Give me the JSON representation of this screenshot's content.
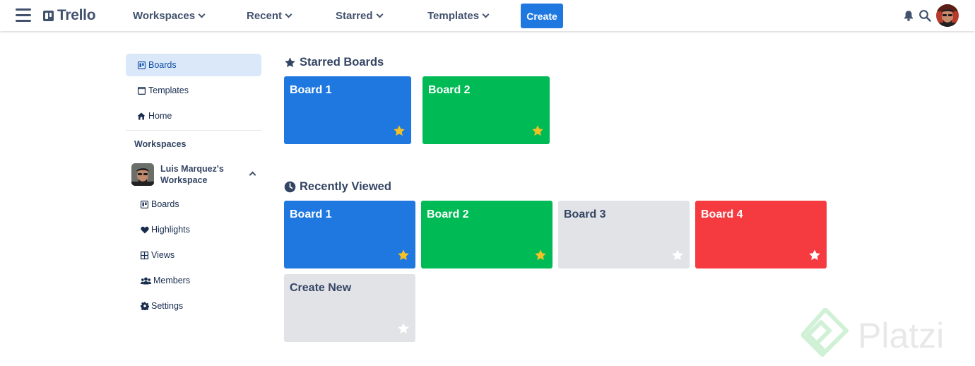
{
  "header": {
    "app_name": "Trello",
    "nav": [
      "Workspaces",
      "Recent",
      "Starred",
      "Templates"
    ],
    "create_label": "Create"
  },
  "sidebar": {
    "links": [
      {
        "label": "Boards",
        "icon": "board-icon",
        "active": true
      },
      {
        "label": "Templates",
        "icon": "template-icon",
        "active": false
      },
      {
        "label": "Home",
        "icon": "home-icon",
        "active": false
      }
    ],
    "workspaces_heading": "Workspaces",
    "workspace_name": "Luis Marquez's Workspace",
    "workspace_links": [
      {
        "label": "Boards",
        "icon": "board-icon"
      },
      {
        "label": "Highlights",
        "icon": "heart-icon"
      },
      {
        "label": "Views",
        "icon": "grid-icon"
      },
      {
        "label": "Members",
        "icon": "members-icon"
      },
      {
        "label": "Settings",
        "icon": "gear-icon"
      }
    ]
  },
  "starred": {
    "title": "Starred Boards",
    "icon": "star-icon",
    "boards": [
      {
        "title": "Board 1",
        "color": "#1f78e0",
        "starred": true
      },
      {
        "title": "Board 2",
        "color": "#00bb55",
        "starred": true
      }
    ]
  },
  "recent": {
    "title": "Recently Viewed",
    "icon": "clock-icon",
    "boards": [
      {
        "title": "Board 1",
        "color": "#1f78e0",
        "starred": true
      },
      {
        "title": "Board 2",
        "color": "#00bb55",
        "starred": true
      },
      {
        "title": "Board 3",
        "color": "#e1e3e7",
        "starred": false
      },
      {
        "title": "Board 4",
        "color": "#f53b40",
        "starred": false
      }
    ],
    "create_new_label": "Create New"
  },
  "colors": {
    "accent": "#1f78e0",
    "star_yellow": "#f4c025",
    "sidebar_active": "#dbe8fa"
  },
  "watermark": "Platzi"
}
